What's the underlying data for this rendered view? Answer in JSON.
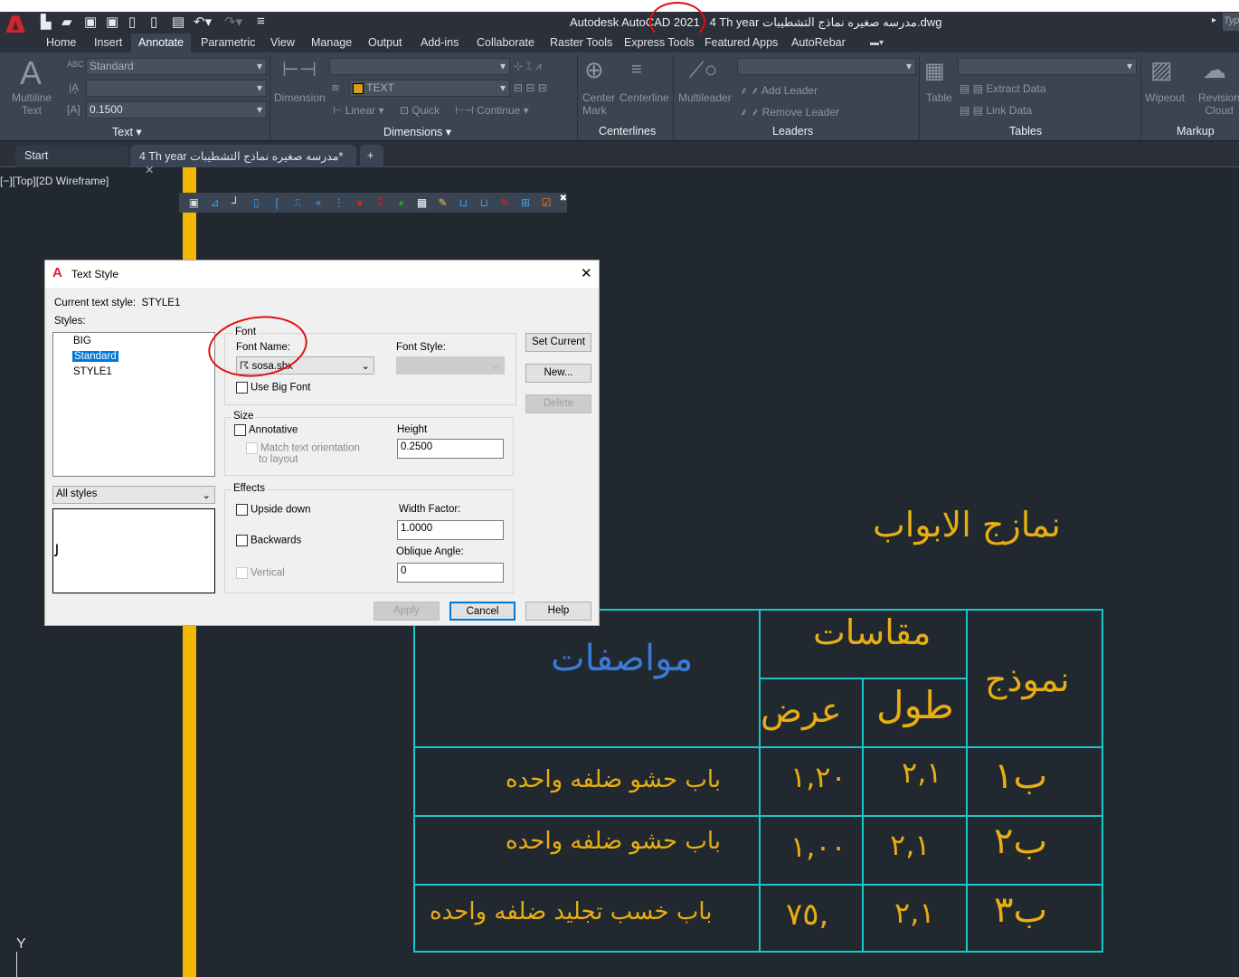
{
  "app": {
    "title": "Autodesk AutoCAD 2021",
    "document": "4 Th  year مدرسه صغيره نماذج التشطيبات.dwg",
    "search_placeholder": "Typ"
  },
  "ribbon_tabs": [
    "Home",
    "Insert",
    "Annotate",
    "Parametric",
    "View",
    "Manage",
    "Output",
    "Add-ins",
    "Collaborate",
    "Raster Tools",
    "Express Tools",
    "Featured Apps",
    "AutoRebar"
  ],
  "active_tab": "Annotate",
  "ribbon": {
    "text": {
      "multiline": "Multiline",
      "multiline2": "Text",
      "style": "Standard",
      "height": "0.1500",
      "title": "Text"
    },
    "dimensions": {
      "dimension": "Dimension",
      "layer": "TEXT",
      "layer_color": "#d4a017",
      "linear": "Linear",
      "quick": "Quick",
      "continue": "Continue",
      "title": "Dimensions"
    },
    "centerlines": {
      "center": "Center",
      "mark": "Mark",
      "centerline": "Centerline",
      "title": "Centerlines"
    },
    "leaders": {
      "multileader": "Multileader",
      "add": "Add Leader",
      "remove": "Remove Leader",
      "title": "Leaders"
    },
    "tables": {
      "table": "Table",
      "extract": "Extract Data",
      "link": "Link Data",
      "title": "Tables"
    },
    "markup": {
      "wipeout": "Wipeout",
      "revision": "Revision",
      "cloud": "Cloud",
      "title": "Markup"
    }
  },
  "doc_tabs": {
    "start": "Start",
    "file": "4 Th  year مدرسه صغيره نماذج التشطيبات*"
  },
  "viewport_label": "[−][Top][2D Wireframe]",
  "dialog": {
    "title": "Text Style",
    "current_label": "Current text style:",
    "current_value": "STYLE1",
    "styles_label": "Styles:",
    "styles": [
      "BIG",
      "Standard",
      "STYLE1"
    ],
    "selected_style": "Standard",
    "filter": "All styles",
    "font_group": "Font",
    "font_name_label": "Font Name:",
    "font_name": "sosa.shx",
    "font_style_label": "Font Style:",
    "use_big_font": "Use Big Font",
    "size_group": "Size",
    "annotative": "Annotative",
    "match": "Match text orientation",
    "match2": "to layout",
    "height_label": "Height",
    "height": "0.2500",
    "effects_group": "Effects",
    "upside": "Upside down",
    "backwards": "Backwards",
    "vertical": "Vertical",
    "width_label": "Width Factor:",
    "width": "1.0000",
    "oblique_label": "Oblique Angle:",
    "oblique": "0",
    "set_current": "Set Current",
    "new": "New...",
    "delete": "Delete",
    "apply": "Apply",
    "cancel": "Cancel",
    "help": "Help"
  },
  "drawing": {
    "title": "نمازج الابواب",
    "headers": {
      "spec": "مواصفات",
      "dims": "مقاسات",
      "width": "عرض",
      "length": "طول",
      "model": "نموذج"
    },
    "rows": [
      {
        "spec": "باب حشو ضلفه واحده",
        "width": "١,٢٠",
        "length": "٢,١",
        "model": "ب١"
      },
      {
        "spec": "باب حشو ضلفه واحده",
        "width": "١,٠٠",
        "length": "٢,١",
        "model": "ب٢"
      },
      {
        "spec": "باب خسب تجليد ضلفه واحده",
        "width": ",٧٥",
        "length": "٢,١",
        "model": "ب٣"
      }
    ],
    "colors": {
      "text": "#e8ae12",
      "grid": "#19c6c9",
      "spec_header": "#3a7bd5"
    }
  },
  "ucs_label": "Y"
}
